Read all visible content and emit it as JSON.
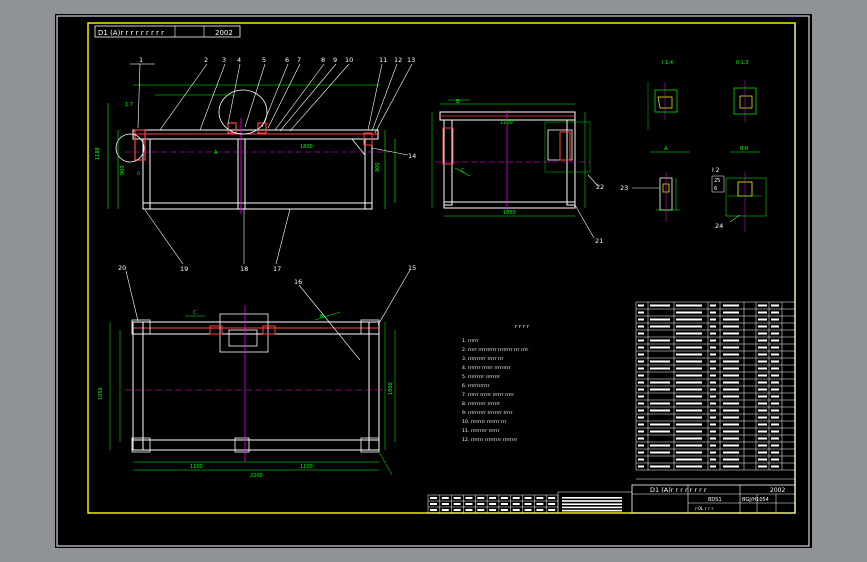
{
  "colors": {
    "background": "#8f9398",
    "paper": "#000000",
    "frame": "#ffffff",
    "dim": "#00ff00",
    "leader": "#ffffff",
    "magenta": "#ff00ff",
    "red": "#ff4040",
    "cyan": "#00ffff",
    "yellow": "#ffff00"
  },
  "header": {
    "drawing_no": "D1 (A)r  r r r r r r r r",
    "year": "2002"
  },
  "views": {
    "main_balloons": [
      "1",
      "2",
      "3",
      "4",
      "5",
      "6",
      "7",
      "8",
      "9",
      "10",
      "11",
      "12",
      "13",
      "14"
    ],
    "main_bottom_balloons": [
      "19",
      "18",
      "17"
    ],
    "side_balloons": [
      "22",
      "21"
    ],
    "detail_balloons": [
      "23",
      "24"
    ],
    "plan_balloons": [
      "20",
      "16",
      "15"
    ],
    "detail_labels": {
      "i": "I 1:4",
      "ii": "II 1:3",
      "a": "A",
      "b": "B-B",
      "c": "I 2"
    }
  },
  "notes": {
    "title": "r r r r",
    "items": [
      "1. rrrrrr",
      "2. rrrrr rrrrrrrrrr rrrrrrrr rrr rrrr",
      "3. rrrrrrrrrr rrrrr rrr",
      "4. rrrrrrr rrrrrr rrrrrrrrr",
      "5. rrrrrrrrr rrrrrrrr",
      "6. rrrrrrrrrrrr",
      "7. rrrrrr rrrrrr rrrrrr rrrrr",
      "8. rrrrrrrrrr rrrrrrr",
      "9. rrrrrrrrrr rrrrrrrr rrrrr",
      "10. rrrrrrrr rrrrrrr rrr",
      "11. rrrrrrrrr rrrrrr",
      "12. rrrrrrr rrrrrrrrr rrrrrrrr"
    ]
  },
  "title_block": {
    "drawing_no": "D1 (A)r r r r r r r r",
    "year": "2002",
    "company": "BDS1",
    "code": "BGJ/H1054",
    "name": "r-0L r r r"
  }
}
